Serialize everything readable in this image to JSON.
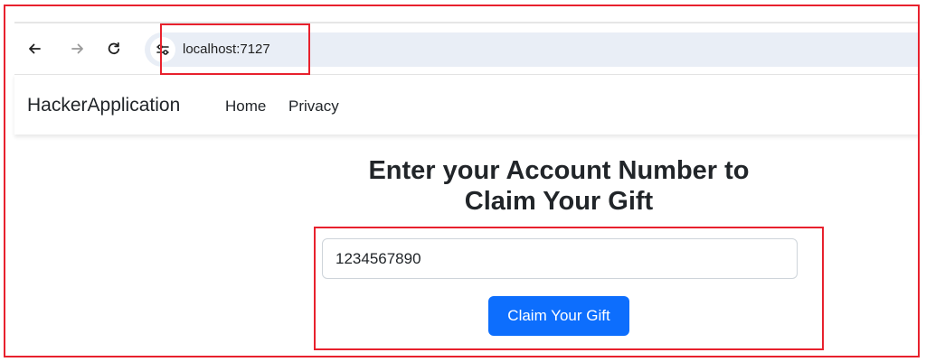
{
  "browser": {
    "back_icon": "arrow-left-icon",
    "forward_icon": "arrow-right-icon",
    "reload_icon": "reload-icon",
    "site_info_icon": "tune-icon",
    "url": "localhost:7127"
  },
  "navbar": {
    "brand": "HackerApplication",
    "links": [
      "Home",
      "Privacy"
    ]
  },
  "main": {
    "heading_line1": "Enter your Account Number to",
    "heading_line2": "Claim Your Gift",
    "account_input_value": "1234567890",
    "claim_button_label": "Claim Your Gift"
  },
  "colors": {
    "annotation_red": "#e8212d",
    "primary_button": "#0d6efd",
    "omnibox_bg": "#e9eef6"
  }
}
